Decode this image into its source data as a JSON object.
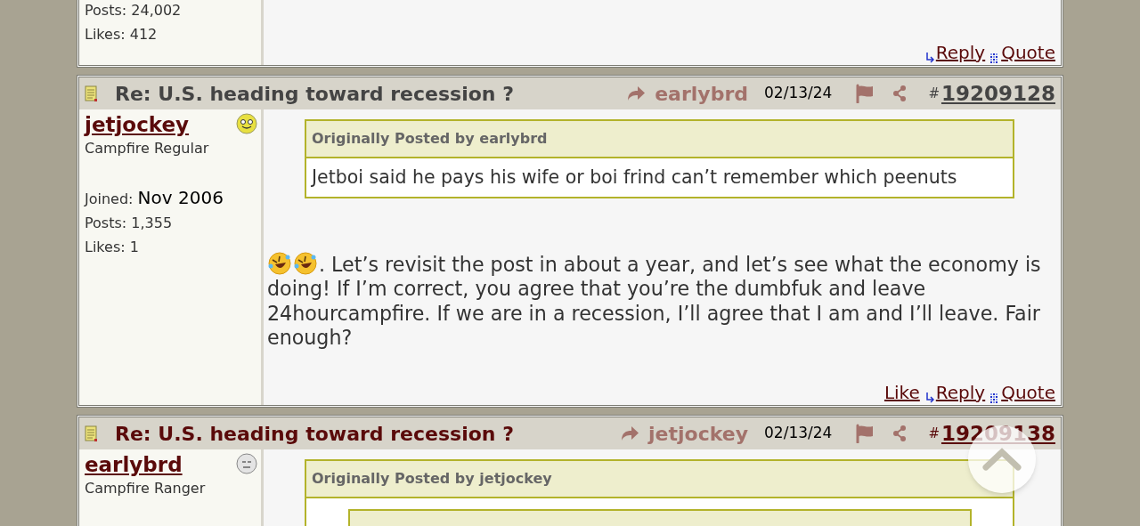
{
  "posts": [
    {
      "kind": "continued",
      "stats": [
        {
          "label": "Posts:",
          "value": "24,002",
          "emphasized": false
        },
        {
          "label": "Likes:",
          "value": "412",
          "emphasized": false
        }
      ],
      "actions": [
        {
          "kind": "reply",
          "label": "Reply"
        },
        {
          "kind": "quote",
          "label": "Quote"
        }
      ]
    },
    {
      "kind": "post",
      "title": "Re: U.S. heading toward recession ?",
      "read": true,
      "reply_to": "earlybrd",
      "date": "02/13/24",
      "hash": "#",
      "number": "19209128",
      "user": {
        "name": "jetjockey",
        "rank": "Campfire Regular",
        "icon": {
          "kind": "happy"
        }
      },
      "stats": [
        {
          "label": "Joined:",
          "value": "Nov 2006",
          "emphasized": true
        },
        {
          "label": "Posts:",
          "value": "1,355",
          "emphasized": false
        },
        {
          "label": "Likes:",
          "value": "1",
          "emphasized": false
        }
      ],
      "quote": {
        "header": "Originally Posted by earlybrd",
        "text": "Jetboi said he pays his wife or boi frind can’t remember which peenuts"
      },
      "emojis": [
        {
          "kind": "laughing"
        },
        {
          "kind": "laughing"
        }
      ],
      "body": ". Let’s revisit the post in about a year, and let’s see what the economy is doing! If I’m correct, you agree that you’re the dumbfuk and leave 24hourcampfire. If we are in a recession, I’ll agree that I am and I’ll leave. Fair enough?",
      "actions": [
        {
          "kind": "like",
          "label": "Like"
        },
        {
          "kind": "reply",
          "label": "Reply"
        },
        {
          "kind": "quote",
          "label": "Quote"
        }
      ]
    },
    {
      "kind": "post",
      "title": "Re: U.S. heading toward recession ?",
      "read": false,
      "reply_to": "jetjockey",
      "date": "02/13/24",
      "hash": "#",
      "number": "19209138",
      "user": {
        "name": "earlybrd",
        "rank": "Campfire Ranger",
        "icon": {
          "kind": "neutral"
        }
      },
      "quote": {
        "header": "Originally Posted by jetjockey",
        "nested": true
      }
    }
  ]
}
